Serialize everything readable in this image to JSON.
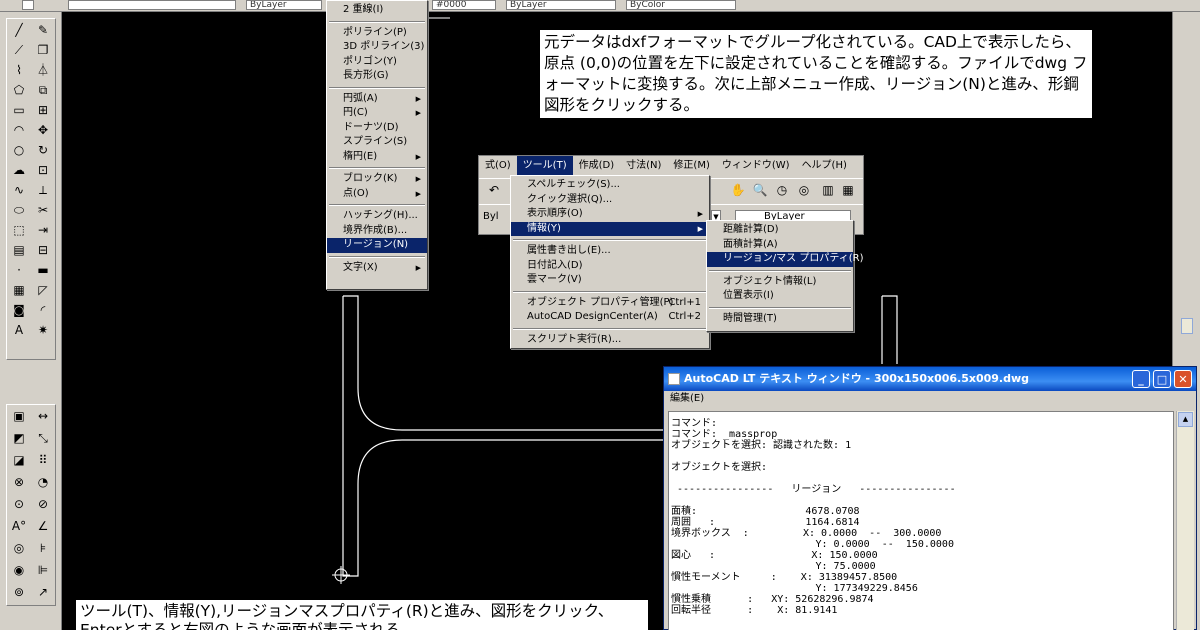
{
  "toolbar": {
    "linetype_combo": "ByLayer",
    "color_combo": "ByLayer",
    "lineweight_combo": "ByColor",
    "color_code": "#0000",
    "layer_combo": ""
  },
  "draw_menu": {
    "items": [
      {
        "label": "2 重線(I)",
        "arrow": false,
        "selected": false
      },
      {
        "sep": true
      },
      {
        "label": "ポリライン(P)",
        "arrow": false,
        "selected": false
      },
      {
        "label": "3D ポリライン(3)",
        "arrow": false,
        "selected": false
      },
      {
        "label": "ポリゴン(Y)",
        "arrow": false,
        "selected": false
      },
      {
        "label": "長方形(G)",
        "arrow": false,
        "selected": false
      },
      {
        "sep": true
      },
      {
        "label": "円弧(A)",
        "arrow": true,
        "selected": false
      },
      {
        "label": "円(C)",
        "arrow": true,
        "selected": false
      },
      {
        "label": "ドーナツ(D)",
        "arrow": false,
        "selected": false
      },
      {
        "label": "スプライン(S)",
        "arrow": false,
        "selected": false
      },
      {
        "label": "楕円(E)",
        "arrow": true,
        "selected": false
      },
      {
        "sep": true
      },
      {
        "label": "ブロック(K)",
        "arrow": true,
        "selected": false
      },
      {
        "label": "点(O)",
        "arrow": true,
        "selected": false
      },
      {
        "sep": true
      },
      {
        "label": "ハッチング(H)...",
        "arrow": false,
        "selected": false
      },
      {
        "label": "境界作成(B)...",
        "arrow": false,
        "selected": false
      },
      {
        "label": "リージョン(N)",
        "arrow": false,
        "selected": true
      },
      {
        "sep": true
      },
      {
        "label": "文字(X)",
        "arrow": true,
        "selected": false
      }
    ]
  },
  "note_top": {
    "text": "元データはdxfフォーマットでグループ化されている。CAD上で表示したら、原点 (0,0)の位置を左下に設定されていることを確認する。ファイルでdwg フォーマットに変換する。次に上部メニュー作成、リージョン(N)と進み、形鋼図形をクリックする。"
  },
  "note_bottom": {
    "text": "ツール(T)、情報(Y),リージョンマスプロパティ(R)と進み、図形をクリック、Enterとすると右図のような画面が表示される。"
  },
  "menubar": {
    "items": [
      "式(O)",
      "ツール(T)",
      "作成(D)",
      "寸法(N)",
      "修正(M)",
      "ウィンドウ(W)",
      "ヘルプ(H)"
    ],
    "open_index": 1,
    "layer_combo": "ByLayer",
    "layer_prefix": "Byl"
  },
  "tools_menu": {
    "items": [
      {
        "label": "スペルチェック(S)...",
        "arrow": false,
        "selected": false
      },
      {
        "label": "クイック選択(Q)...",
        "arrow": false,
        "selected": false
      },
      {
        "label": "表示順序(O)",
        "arrow": true,
        "selected": false
      },
      {
        "label": "情報(Y)",
        "arrow": true,
        "selected": true
      },
      {
        "sep": true
      },
      {
        "label": "属性書き出し(E)...",
        "arrow": false,
        "selected": false
      },
      {
        "label": "日付記入(D)",
        "arrow": false,
        "selected": false
      },
      {
        "label": "雲マーク(V)",
        "arrow": false,
        "selected": false
      },
      {
        "sep": true
      },
      {
        "label": "オブジェクト プロパティ管理(P)",
        "shortcut": "Ctrl+1",
        "arrow": false,
        "selected": false
      },
      {
        "label": "AutoCAD DesignCenter(A)",
        "shortcut": "Ctrl+2",
        "arrow": false,
        "selected": false
      },
      {
        "sep": true
      },
      {
        "label": "スクリプト実行(R)...",
        "arrow": false,
        "selected": false
      }
    ]
  },
  "info_menu": {
    "items": [
      {
        "label": "距離計算(D)",
        "selected": false
      },
      {
        "label": "面積計算(A)",
        "selected": false
      },
      {
        "label": "リージョン/マス プロパティ(R)",
        "selected": true
      },
      {
        "sep": true
      },
      {
        "label": "オブジェクト情報(L)",
        "selected": false
      },
      {
        "label": "位置表示(I)",
        "selected": false
      },
      {
        "sep": true
      },
      {
        "label": "時間管理(T)",
        "selected": false
      }
    ]
  },
  "text_window": {
    "title": "AutoCAD LT テキスト ウィンドウ - 300x150x006.5x009.dwg",
    "menu": "編集(E)",
    "lines": [
      "コマンド:",
      "コマンド: _massprop",
      "オブジェクトを選択: 認識された数: 1",
      "",
      "オブジェクトを選択:",
      "",
      " ----------------   リージョン   ----------------",
      "",
      "面積:                  4678.0708",
      "周囲   :               1164.6814",
      "境界ボックス  :         X: 0.0000  --  300.0000",
      "                        Y: 0.0000  --  150.0000",
      "図心   :                X: 150.0000",
      "                        Y: 75.0000",
      "慣性モーメント     :    X: 31389457.8500",
      "                        Y: 177349229.8456",
      "慣性乗積      :   XY: 52628296.9874",
      "回転半径      :    X: 81.9141"
    ]
  }
}
